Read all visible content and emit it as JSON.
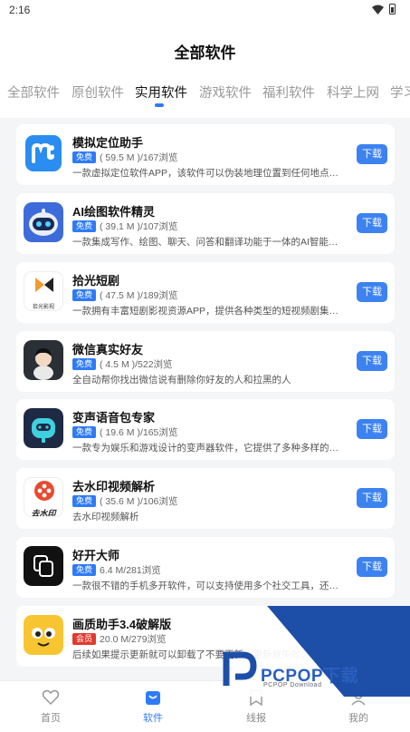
{
  "status_bar": {
    "time": "2:16"
  },
  "header": {
    "title": "全部软件",
    "tabs": [
      "全部软件",
      "原创软件",
      "实用软件",
      "游戏软件",
      "福利软件",
      "科学上网",
      "学习"
    ],
    "active_tab": "实用软件"
  },
  "apps": [
    {
      "name": "模拟定位助手",
      "badge": "免费",
      "size": "( 59.5 M )",
      "views": "/167浏览",
      "desc": "一款虚拟定位软件APP，该软件可以伪装地理位置到任何地点，也...",
      "button": "下载",
      "icon": "location-m-icon",
      "color": "#2a8df0"
    },
    {
      "name": "AI绘图软件精灵",
      "badge": "免费",
      "size": "( 39.1 M )",
      "views": "/107浏览",
      "desc": "一款集成写作、绘图、聊天、问答和翻译功能于一体的AI智能应用...",
      "button": "下载",
      "icon": "robot-icon",
      "color": "#3d6bd9"
    },
    {
      "name": "拾光短剧",
      "badge": "免费",
      "size": "( 47.5 M )",
      "views": "/189浏览",
      "desc": "一款拥有丰富短剧影视资源APP，提供各种类型的短视频剧集，包...",
      "button": "下载",
      "icon": "play-bowtie-icon",
      "color": "#f29b2c",
      "icon_caption": "拾光影视"
    },
    {
      "name": "微信真实好友",
      "badge": "免费",
      "size": "( 4.5 M )",
      "views": "/522浏览",
      "desc": "全自动帮你找出微信说有删除你好友的人和拉黑的人",
      "button": "下载",
      "icon": "cartoon-boy-icon",
      "color": "#2b2f36"
    },
    {
      "name": "变声语音包专家",
      "badge": "免费",
      "size": "( 19.6 M )",
      "views": "/165浏览",
      "desc": "一款专为娱乐和游戏设计的变声器软件，它提供了多种多样的变声...",
      "button": "下载",
      "icon": "voice-robot-icon",
      "color": "#1e2a44"
    },
    {
      "name": "去水印视频解析",
      "badge": "免费",
      "size": "( 35.6 M )",
      "views": "/106浏览",
      "desc": "去水印视频解析",
      "button": "下载",
      "icon": "film-reel-icon",
      "color": "#e84a2f",
      "icon_caption": "去水印"
    },
    {
      "name": "好开大师",
      "badge": "免费",
      "size": "6.4 M",
      "views": "/281浏览",
      "desc": "一款很不错的手机多开软件，可以支持使用多个社交工具，还能进...",
      "button": "下载",
      "icon": "multi-window-icon",
      "color": "#111111"
    },
    {
      "name": "画质助手3.4破解版",
      "badge": "会员",
      "size": "20.0 M",
      "views": "/279浏览",
      "desc": "后续如果提示更新就可以卸载了不要更新，更新就失效，",
      "button": "下载",
      "icon": "yellow-face-icon",
      "color": "#f7c531"
    }
  ],
  "watermark": {
    "text": "PCPOP下载",
    "sub": "PCPOP Download"
  },
  "bottom_nav": [
    {
      "label": "首页",
      "icon": "heart-icon"
    },
    {
      "label": "软件",
      "icon": "bag-icon",
      "active": true
    },
    {
      "label": "线报",
      "icon": "bookmark-icon"
    },
    {
      "label": "我的",
      "icon": "user-icon"
    }
  ],
  "colors": {
    "accent": "#2f7bf6",
    "vip": "#e23a2e",
    "watermark": "#1e4fa8"
  }
}
